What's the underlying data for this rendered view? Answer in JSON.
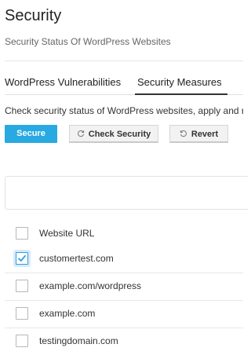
{
  "page": {
    "title": "Security",
    "subtitle": "Security Status Of WordPress Websites"
  },
  "tabs": [
    {
      "label": "WordPress Vulnerabilities",
      "active": false
    },
    {
      "label": "Security Measures",
      "active": true
    }
  ],
  "description": "Check security status of WordPress websites, apply and revert security measures.",
  "toolbar": {
    "secure_label": "Secure",
    "check_label": "Check Security",
    "revert_label": "Revert",
    "check_icon": "refresh-icon",
    "revert_icon": "undo-icon"
  },
  "table": {
    "header_label": "Website URL",
    "rows": [
      {
        "url": "customertest.com",
        "checked": true
      },
      {
        "url": "example.com/wordpress",
        "checked": false
      },
      {
        "url": "example.com",
        "checked": false
      },
      {
        "url": "testingdomain.com",
        "checked": false
      }
    ]
  },
  "colors": {
    "accent": "#28a9e2",
    "checkbox_checked": "#2e9ee5"
  }
}
